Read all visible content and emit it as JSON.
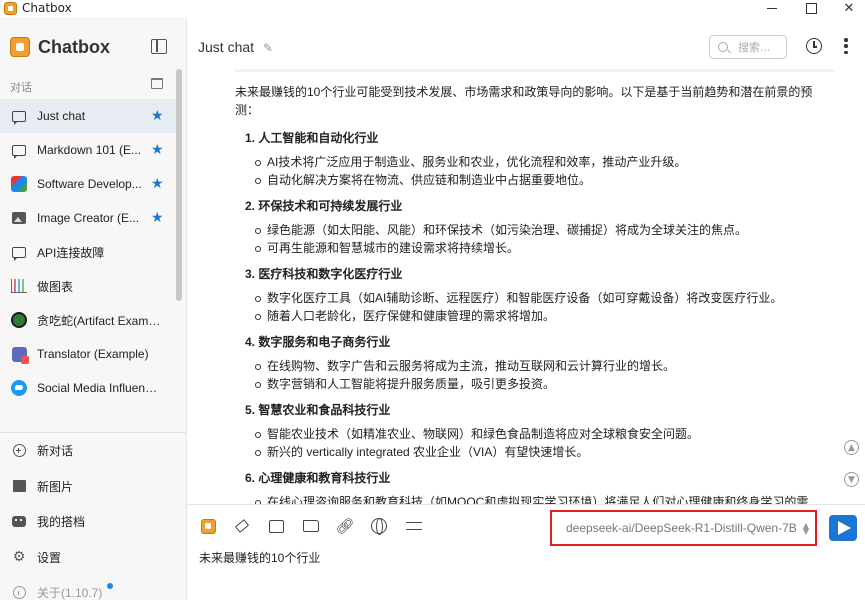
{
  "window": {
    "title": "Chatbox"
  },
  "sidebar": {
    "brand": "Chatbox",
    "section_label": "对话",
    "chats": [
      {
        "label": "Just chat",
        "icon": "chat-bubble-icon",
        "starred": true,
        "active": true
      },
      {
        "label": "Markdown 101 (E...",
        "icon": "chat-bubble-icon",
        "starred": true
      },
      {
        "label": "Software Develop...",
        "icon": "software-avatar-icon",
        "starred": true
      },
      {
        "label": "Image Creator (E...",
        "icon": "image-icon",
        "starred": true
      },
      {
        "label": "API连接故障",
        "icon": "chat-bubble-icon",
        "starred": false
      },
      {
        "label": "做图表",
        "icon": "chart-avatar-icon",
        "starred": false
      },
      {
        "label": "贪吃蛇(Artifact Example)",
        "icon": "snake-avatar-icon",
        "starred": false
      },
      {
        "label": "Translator (Example)",
        "icon": "translator-avatar-icon",
        "starred": false
      },
      {
        "label": "Social Media Influence...",
        "icon": "twitter-avatar-icon",
        "starred": false
      }
    ],
    "nav": [
      {
        "label": "新对话",
        "icon": "plus-circle-icon"
      },
      {
        "label": "新图片",
        "icon": "new-image-icon"
      },
      {
        "label": "我的搭档",
        "icon": "robot-icon"
      },
      {
        "label": "设置",
        "icon": "gear-icon"
      },
      {
        "label": "关于(1.10.7)",
        "icon": "info-icon"
      }
    ]
  },
  "header": {
    "title": "Just chat",
    "search_placeholder": "搜索..."
  },
  "message": {
    "intro": "未来最赚钱的10个行业可能受到技术发展、市场需求和政策导向的影响。以下是基于当前趋势和潜在前景的预测：",
    "sections": [
      {
        "title": "1. 人工智能和自动化行业",
        "items": [
          "AI技术将广泛应用于制造业、服务业和农业，优化流程和效率，推动产业升级。",
          "自动化解决方案将在物流、供应链和制造业中占据重要地位。"
        ]
      },
      {
        "title": "2. 环保技术和可持续发展行业",
        "items": [
          "绿色能源（如太阳能、风能）和环保技术（如污染治理、碳捕捉）将成为全球关注的焦点。",
          "可再生能源和智慧城市的建设需求将持续增长。"
        ]
      },
      {
        "title": "3. 医疗科技和数字化医疗行业",
        "items": [
          "数字化医疗工具（如AI辅助诊断、远程医疗）和智能医疗设备（如可穿戴设备）将改变医疗行业。",
          "随着人口老龄化，医疗保健和健康管理的需求将增加。"
        ]
      },
      {
        "title": "4. 数字服务和电子商务行业",
        "items": [
          "在线购物、数字广告和云服务将成为主流，推动互联网和云计算行业的增长。",
          "数字营销和人工智能将提升服务质量，吸引更多投资。"
        ]
      },
      {
        "title": "5. 智慧农业和食品科技行业",
        "items": [
          "智能农业技术（如精准农业、物联网）和绿色食品制造将应对全球粮食安全问题。",
          "新兴的 vertically integrated 农业企业（VIA）有望快速增长。"
        ]
      },
      {
        "title": "6. 心理健康和教育科技行业",
        "items": [
          "在线心理咨询服务和教育科技（如MOOC和虚拟现实学习环境）将满足人们对心理健康和终身学习的需求。"
        ]
      }
    ]
  },
  "composer": {
    "model": "deepseek-ai/DeepSeek-R1-Distill-Qwen-7B",
    "input_text": "未来最赚钱的10个行业"
  },
  "colors": {
    "accent": "#1976d2",
    "highlight_border": "#e02020",
    "brand_orange": "#f0a030"
  }
}
